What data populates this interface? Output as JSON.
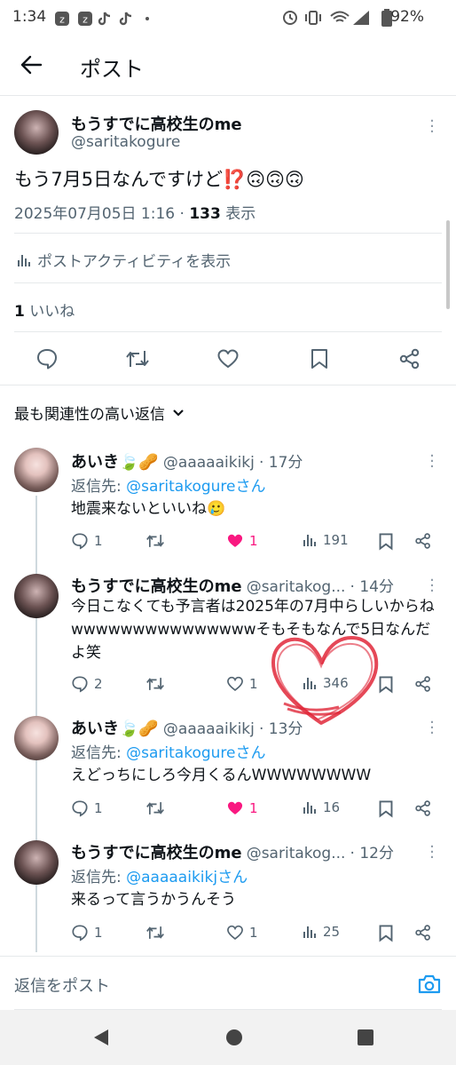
{
  "status_bar": {
    "time": "1:34",
    "battery": "92%"
  },
  "header": {
    "title": "ポスト"
  },
  "post": {
    "author_name": "もうすでに高校生のme",
    "author_handle": "@saritakogure",
    "text": "もう7月5日なんですけど⁉️🙃🙃🙃",
    "date": "2025年07月05日 1:16",
    "dot": "·",
    "views_count": "133",
    "views_label": "表示",
    "activity_label": "ポストアクティビティを表示",
    "likes_count": "1",
    "likes_label": "いいね"
  },
  "sort": {
    "label": "最も関連性の高い返信"
  },
  "replies": [
    {
      "name": "あいき🍃🥜",
      "handle": "@aaaaaikikj",
      "time": "· 17分",
      "reply_to_prefix": "返信先: ",
      "reply_to": "@saritakogureさん",
      "text": "地震来ないといいね🥲",
      "replies": "1",
      "retweets": "",
      "likes": "1",
      "views": "191",
      "liked": true
    },
    {
      "name": "もうすでに高校生のme",
      "handle": "@saritakog...",
      "time": "· 14分",
      "text": "今日こなくても予言者は2025年の7月中らしいからねwwwwwwwwwwwwwwwそもそもなんで5日なんだよ笑",
      "replies": "2",
      "retweets": "",
      "likes": "1",
      "views": "346",
      "liked": false
    },
    {
      "name": "あいき🍃🥜",
      "handle": "@aaaaaikikj",
      "time": "· 13分",
      "reply_to_prefix": "返信先: ",
      "reply_to": "@saritakogureさん",
      "text": "えどっちにしろ今月くるんWWWWWWWW",
      "replies": "1",
      "retweets": "",
      "likes": "1",
      "views": "16",
      "liked": true
    },
    {
      "name": "もうすでに高校生のme",
      "handle": "@saritakog...",
      "time": "· 12分",
      "reply_to_prefix": "返信先: ",
      "reply_to": "@aaaaaikikjさん",
      "text": "来るって言うかうんそう",
      "replies": "1",
      "retweets": "",
      "likes": "1",
      "views": "25",
      "liked": false
    }
  ],
  "compose": {
    "placeholder": "返信をポスト"
  },
  "colors": {
    "accent": "#1d9bf0",
    "like": "#f91880",
    "text": "#0f1419",
    "secondary": "#536471",
    "annotation": "#e0283a"
  },
  "icons": [
    "back-arrow-icon",
    "more-dots-icon",
    "reply-icon",
    "retweet-icon",
    "like-icon",
    "bookmark-icon",
    "share-icon",
    "views-icon",
    "camera-icon",
    "chevron-down-icon"
  ]
}
